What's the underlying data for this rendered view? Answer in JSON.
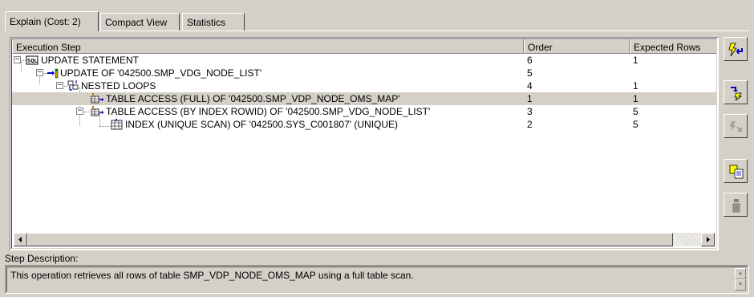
{
  "tabs": [
    {
      "label": "Explain (Cost: 2)",
      "active": true
    },
    {
      "label": "Compact View",
      "active": false
    },
    {
      "label": "Statistics",
      "active": false
    }
  ],
  "grid": {
    "columns": [
      "Execution Step",
      "Order",
      "Expected Rows"
    ],
    "rows": [
      {
        "step": "UPDATE STATEMENT",
        "order": "6",
        "expected_rows": "1",
        "icon": "sql-statement-icon",
        "selected": false
      },
      {
        "step": "UPDATE OF '042500.SMP_VDG_NODE_LIST'",
        "order": "5",
        "expected_rows": "",
        "icon": "update-icon",
        "selected": false
      },
      {
        "step": "NESTED LOOPS",
        "order": "4",
        "expected_rows": "1",
        "icon": "nested-loops-icon",
        "selected": false
      },
      {
        "step": "TABLE ACCESS (FULL) OF '042500.SMP_VDP_NODE_OMS_MAP'",
        "order": "1",
        "expected_rows": "1",
        "icon": "table-access-icon",
        "selected": true
      },
      {
        "step": "TABLE ACCESS (BY INDEX ROWID) OF '042500.SMP_VDG_NODE_LIST'",
        "order": "3",
        "expected_rows": "5",
        "icon": "table-access-icon",
        "selected": false
      },
      {
        "step": "INDEX (UNIQUE SCAN) OF '042500.SYS_C001807' (UNIQUE)",
        "order": "2",
        "expected_rows": "5",
        "icon": "index-icon",
        "selected": false
      }
    ]
  },
  "toolbar": {
    "buttons": [
      {
        "name": "run-explain-button",
        "icon": "lightning-arrow-icon"
      },
      {
        "name": "step-next-button",
        "icon": "step-arrow-icon"
      },
      {
        "name": "step-prev-button",
        "icon": "disabled-step-icon"
      },
      {
        "name": "copy-button",
        "icon": "copy-icon"
      },
      {
        "name": "info-button",
        "icon": "info-icon"
      }
    ]
  },
  "description": {
    "label": "Step Description:",
    "text": "This operation retrieves all rows of table SMP_VDP_NODE_OMS_MAP using a full table scan."
  },
  "colors": {
    "face": "#d4d0c8",
    "selected_row": "#d4d0c8",
    "accent_blue": "#0000c0",
    "accent_yellow": "#ffff00"
  }
}
